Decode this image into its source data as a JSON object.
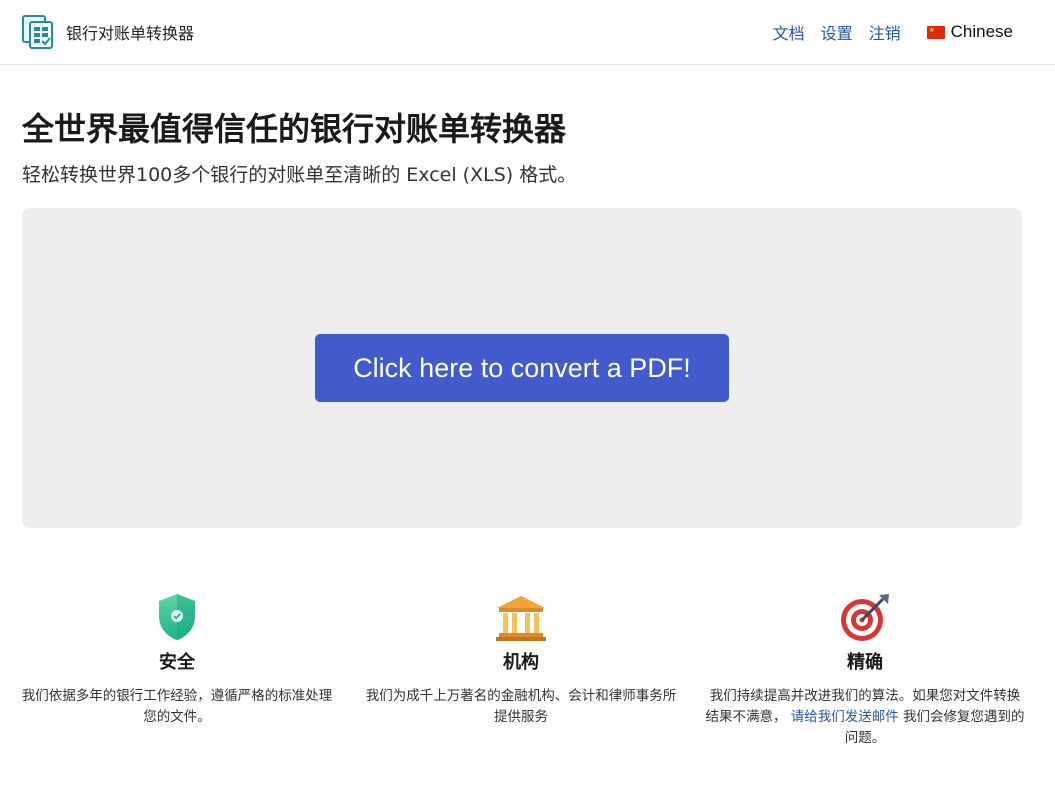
{
  "header": {
    "brand_name": "银行对账单转换器",
    "nav": {
      "docs": "文档",
      "settings": "设置",
      "logout": "注销"
    },
    "language": "Chinese"
  },
  "hero": {
    "title": "全世界最值得信任的银行对账单转换器",
    "subtitle": "轻松转换世界100多个银行的对账单至清晰的 Excel (XLS) 格式。"
  },
  "dropzone": {
    "button_label": "Click here to convert a PDF!"
  },
  "features": [
    {
      "icon": "shield-check-icon",
      "title": "安全",
      "text": "我们依据多年的银行工作经验，遵循严格的标准处理您的文件。"
    },
    {
      "icon": "bank-building-icon",
      "title": "机构",
      "text": "我们为成千上万著名的金融机构、会计和律师事务所提供服务"
    },
    {
      "icon": "target-dart-icon",
      "title": "精确",
      "text_before": "我们持续提高并改进我们的算法。如果您对文件转换结果不满意， ",
      "link": "请给我们发送邮件",
      "text_after": " 我们会修复您遇到的问题。"
    }
  ],
  "colors": {
    "accent": "#425bcc",
    "link": "#2a56a8",
    "dropzone_bg": "#efeeed"
  }
}
